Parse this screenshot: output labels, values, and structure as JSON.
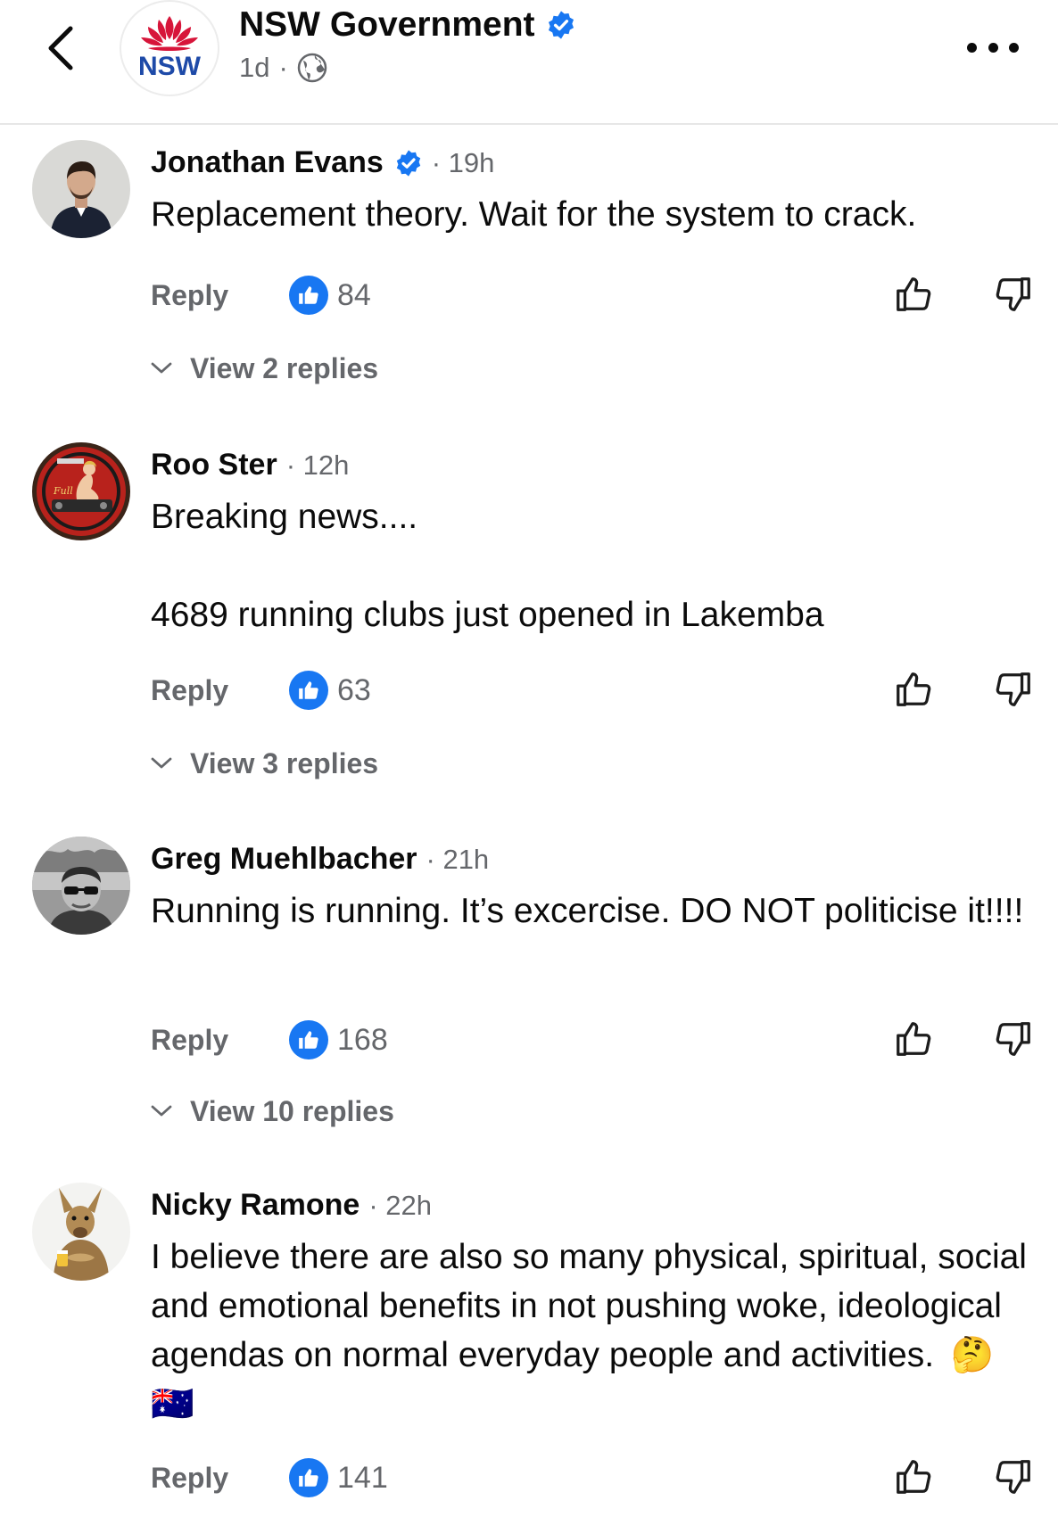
{
  "header": {
    "page_name": "NSW Government",
    "time": "1d",
    "separator": "·",
    "logo_text": "NSW"
  },
  "comments": [
    {
      "author": "Jonathan Evans",
      "verified": true,
      "time": "· 19h",
      "text": [
        "Replacement theory. Wait for the system to crack."
      ],
      "reply_label": "Reply",
      "likes": "84",
      "view_replies": "View 2 replies"
    },
    {
      "author": "Roo Ster",
      "verified": false,
      "time": "· 12h",
      "text": [
        "Breaking news....",
        "4689 running clubs just opened in Lakemba"
      ],
      "reply_label": "Reply",
      "likes": "63",
      "view_replies": "View 3 replies"
    },
    {
      "author": "Greg Muehlbacher",
      "verified": false,
      "time": "· 21h",
      "text": [
        "Running is running. It’s excercise. DO NOT politicise it!!!!"
      ],
      "reply_label": "Reply",
      "likes": "168",
      "view_replies": "View 10 replies"
    },
    {
      "author": "Nicky Ramone",
      "verified": false,
      "time": "· 22h",
      "text": [
        "I believe there are also so many physical, spiritual, social and emotional benefits in not pushing woke, ideological agendas on normal everyday people and activities."
      ],
      "emoji": "🤔 🇦🇺",
      "reply_label": "Reply",
      "likes": "141"
    }
  ],
  "colors": {
    "accent_blue": "#1877f2",
    "secondary_text": "#65676b",
    "nsw_red": "#d7153a",
    "nsw_blue": "#1e4aa8"
  }
}
